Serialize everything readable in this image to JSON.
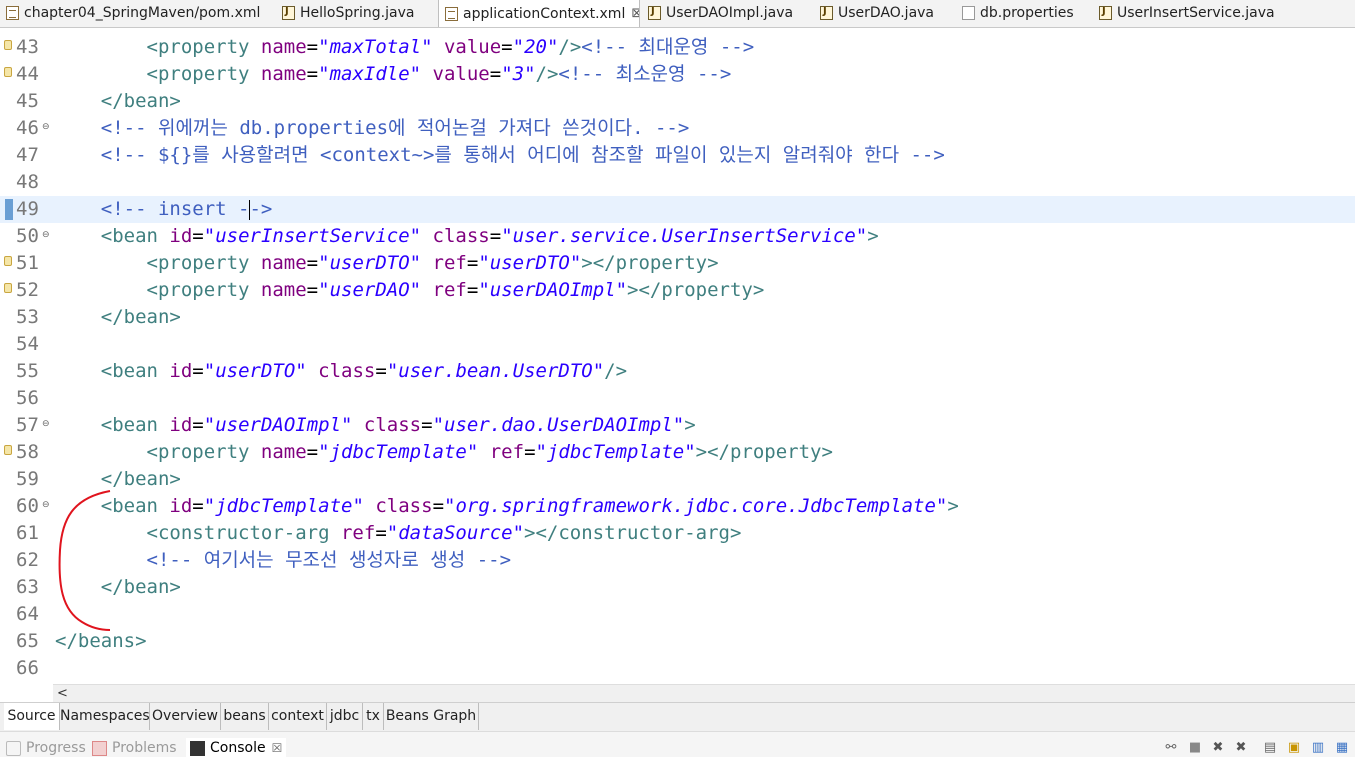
{
  "tabs": [
    {
      "label": "chapter04_SpringMaven/pom.xml",
      "icon": "xml-file-icon"
    },
    {
      "label": "HelloSpring.java",
      "icon": "java-file-icon"
    },
    {
      "label": "applicationContext.xml",
      "icon": "xml-file-icon",
      "active": true,
      "close": "⊠"
    },
    {
      "label": "UserDAOImpl.java",
      "icon": "java-file-icon"
    },
    {
      "label": "UserDAO.java",
      "icon": "java-file-icon"
    },
    {
      "label": "db.properties",
      "icon": "properties-file-icon"
    },
    {
      "label": "UserInsertService.java",
      "icon": "java-file-icon"
    }
  ],
  "editor": {
    "lines": [
      {
        "n": "43",
        "mark": "warn",
        "fold": ""
      },
      {
        "n": "44",
        "mark": "warn",
        "fold": ""
      },
      {
        "n": "45",
        "mark": "",
        "fold": ""
      },
      {
        "n": "46",
        "mark": "",
        "fold": "⊖"
      },
      {
        "n": "47",
        "mark": "",
        "fold": ""
      },
      {
        "n": "48",
        "mark": "",
        "fold": ""
      },
      {
        "n": "49",
        "mark": "cur",
        "fold": ""
      },
      {
        "n": "50",
        "mark": "",
        "fold": "⊖"
      },
      {
        "n": "51",
        "mark": "warn",
        "fold": ""
      },
      {
        "n": "52",
        "mark": "warn",
        "fold": ""
      },
      {
        "n": "53",
        "mark": "",
        "fold": ""
      },
      {
        "n": "54",
        "mark": "",
        "fold": ""
      },
      {
        "n": "55",
        "mark": "",
        "fold": ""
      },
      {
        "n": "56",
        "mark": "",
        "fold": ""
      },
      {
        "n": "57",
        "mark": "",
        "fold": "⊖"
      },
      {
        "n": "58",
        "mark": "warn",
        "fold": ""
      },
      {
        "n": "59",
        "mark": "",
        "fold": ""
      },
      {
        "n": "60",
        "mark": "",
        "fold": "⊖"
      },
      {
        "n": "61",
        "mark": "",
        "fold": ""
      },
      {
        "n": "62",
        "mark": "",
        "fold": ""
      },
      {
        "n": "63",
        "mark": "",
        "fold": ""
      },
      {
        "n": "64",
        "mark": "",
        "fold": ""
      },
      {
        "n": "65",
        "mark": "",
        "fold": ""
      },
      {
        "n": "66",
        "mark": "",
        "fold": ""
      }
    ],
    "code": {
      "l43": {
        "indent": "        ",
        "open": "<property ",
        "a1": "name",
        "v1": "\"maxTotal\"",
        "a2": "value",
        "v2": "\"20\"",
        "close": "/>",
        "comment": "<!-- 최대운영 -->"
      },
      "l44": {
        "indent": "        ",
        "open": "<property ",
        "a1": "name",
        "v1": "\"maxIdle\"",
        "a2": "value",
        "v2": "\"3\"",
        "close": "/>",
        "comment": "<!-- 최소운영 -->"
      },
      "l45": {
        "indent": "    ",
        "tag": "</bean>"
      },
      "l46": {
        "indent": "    ",
        "comment": "<!-- 위에꺼는 db.properties에 적어논걸 가져다 쓴것이다. -->"
      },
      "l47": {
        "indent": "    ",
        "comment": "<!-- ${}를 사용할려면 <context~>를 통해서 어디에 참조할 파일이 있는지 알려줘야 한다 -->"
      },
      "l49": {
        "indent": "    ",
        "before": "<!-- insert -",
        "after": "->"
      },
      "l50": {
        "indent": "    ",
        "open": "<bean ",
        "a1": "id",
        "v1": "\"userInsertService\"",
        "a2": "class",
        "v2": "\"user.service.UserInsertService\"",
        "close": ">"
      },
      "l51": {
        "indent": "        ",
        "open": "<property ",
        "a1": "name",
        "v1": "\"userDTO\"",
        "a2": "ref",
        "v2": "\"userDTO\"",
        "close": "></property>"
      },
      "l52": {
        "indent": "        ",
        "open": "<property ",
        "a1": "name",
        "v1": "\"userDAO\"",
        "a2": "ref",
        "v2": "\"userDAOImpl\"",
        "close": "></property>"
      },
      "l53": {
        "indent": "    ",
        "tag": "</bean>"
      },
      "l55": {
        "indent": "    ",
        "open": "<bean ",
        "a1": "id",
        "v1": "\"userDTO\"",
        "a2": "class",
        "v2": "\"user.bean.UserDTO\"",
        "close": "/>"
      },
      "l57": {
        "indent": "    ",
        "open": "<bean ",
        "a1": "id",
        "v1": "\"userDAOImpl\"",
        "a2": "class",
        "v2": "\"user.dao.UserDAOImpl\"",
        "close": ">"
      },
      "l58": {
        "indent": "        ",
        "open": "<property ",
        "a1": "name",
        "v1": "\"jdbcTemplate\"",
        "a2": "ref",
        "v2": "\"jdbcTemplate\"",
        "close": "></property>"
      },
      "l59": {
        "indent": "    ",
        "tag": "</bean>"
      },
      "l60": {
        "indent": "    ",
        "open": "<bean ",
        "a1": "id",
        "v1": "\"jdbcTemplate\"",
        "a2": "class",
        "v2": "\"org.springframework.jdbc.core.JdbcTemplate\"",
        "close": ">"
      },
      "l61": {
        "indent": "        ",
        "open": "<constructor-arg ",
        "a1": "ref",
        "v1": "\"dataSource\"",
        "close": "></constructor-arg>"
      },
      "l62": {
        "indent": "        ",
        "comment": "<!-- 여기서는 무조선 생성자로 생성 -->"
      },
      "l63": {
        "indent": "    ",
        "tag": "</bean>"
      },
      "l65": {
        "indent": "",
        "tag": "</beans>"
      }
    }
  },
  "hscroll": {
    "arrow": "<"
  },
  "editor_tabs": [
    "Source",
    "Namespaces",
    "Overview",
    "beans",
    "context",
    "jdbc",
    "tx",
    "Beans Graph"
  ],
  "views": [
    {
      "label": "Progress",
      "icon": "progress-icon"
    },
    {
      "label": "Problems",
      "icon": "problems-icon"
    },
    {
      "label": "Console",
      "icon": "console-icon",
      "close": "☒"
    }
  ],
  "colors": {
    "tag": "#3f7f7f",
    "attr": "#7f007f",
    "value": "#2a00ff",
    "comment": "#3f5fbf",
    "current_line": "#e8f2fe",
    "annotation": "#e0141e"
  }
}
